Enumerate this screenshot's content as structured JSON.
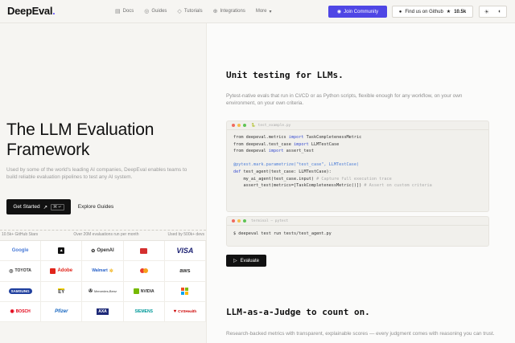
{
  "nav": {
    "brand": "DeepEval",
    "brand_dot": ".",
    "links": [
      {
        "icon": "document-icon",
        "label": "Docs"
      },
      {
        "icon": "book-icon",
        "label": "Guides"
      },
      {
        "icon": "graduation-icon",
        "label": "Tutorials"
      },
      {
        "icon": "plug-icon",
        "label": "Integrations"
      },
      {
        "icon": "",
        "label": "More"
      }
    ],
    "more_chevron": "▾",
    "join_label": "Join Community",
    "github_label": "Find us on Github",
    "github_stars": "10.5k",
    "theme_icons": [
      "☀",
      "◐"
    ]
  },
  "hero": {
    "title": "The LLM Evaluation Framework",
    "subtitle": "Used by some of the world's leading AI companies, DeepEval enables teams to build reliable evaluation pipelines to test any AI system.",
    "start_label": "Get Started",
    "start_arrow": "↗",
    "start_kbd": "⌘ ↵",
    "guides_label": "Explore Guides"
  },
  "stats": [
    "10.5k+ GitHub Stars",
    "Over 20M evaluations run per month",
    "Used by 500k+ devs"
  ],
  "logos": [
    "Google",
    "▲",
    "OpenAI",
    "",
    "VISA",
    "TOYOTA",
    "Adobe",
    "Walmart",
    "",
    "aws",
    "SAMSUNG",
    "EY",
    "Mercedes-Benz",
    "NVIDIA",
    "",
    "BOSCH",
    "Pfizer",
    "AXA",
    "SIEMENS",
    "CVSHealth"
  ],
  "unit": {
    "title": "Unit testing for LLMs.",
    "subtitle": "Pytest-native evals that run in CI/CD or as Python scripts, flexible enough for any workflow, on your own environment, on your own criteria.",
    "file_name": "test_example.py",
    "code": [
      [
        "from deepeval.metrics ",
        "import",
        " TaskCompletenessMetric"
      ],
      [
        "from deepeval.test_case ",
        "import",
        " LLMTestCase"
      ],
      [
        "from deepeval ",
        "import",
        " assert_test"
      ],
      [
        "",
        "",
        ""
      ],
      [
        "@pytest.mark.parametrize(\"test_case\", LLMTestCase)",
        "",
        ""
      ],
      [
        "def",
        " test_agent(test_case: LLMTestCase):",
        ""
      ],
      [
        "    my_ai_agent(test_case.input) ",
        "# Capture full execution trace",
        ""
      ],
      [
        "    assert_test(metrics=[TaskCompletenessMetric()]) ",
        "# Assert on custom criteria",
        ""
      ]
    ],
    "term_name": "terminal — pytest",
    "command": "$ deepeval test run tests/test_agent.py",
    "evaluate_label": "Evaluate"
  },
  "judge": {
    "title": "LLM-as-a-Judge to count on.",
    "subtitle": "Research-backed metrics with transparent, explainable scores — every judgment comes with reasoning you can trust."
  }
}
